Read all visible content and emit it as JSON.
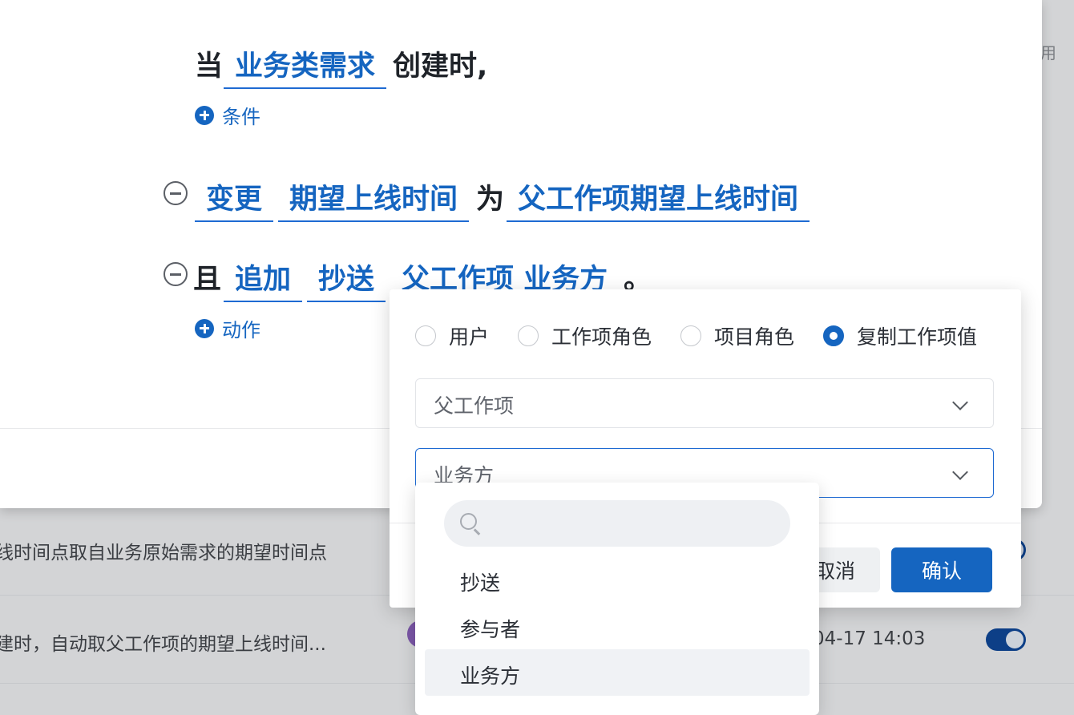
{
  "background": {
    "right_label": "用",
    "rows": [
      {
        "text": "线时间点取自业务原始需求的期望时间点",
        "time": ""
      },
      {
        "text": "建时，自动取父工作项的期望上线时间...",
        "time": "04-17 14:03"
      }
    ]
  },
  "rule": {
    "trigger": {
      "prefix": "当",
      "object": "业务类需求",
      "suffix": "创建时,"
    },
    "add_condition_label": "条件",
    "action1": {
      "verb": "变更",
      "field": "期望上线时间",
      "connector": "为",
      "value": "父工作项期望上线时间"
    },
    "action2": {
      "conjunction": "且",
      "verb": "追加",
      "field": "抄送",
      "value": "父工作项 业务方",
      "end": "。"
    },
    "add_action_label": "动作"
  },
  "popover": {
    "radios": [
      {
        "label": "用户",
        "checked": false
      },
      {
        "label": "工作项角色",
        "checked": false
      },
      {
        "label": "项目角色",
        "checked": false
      },
      {
        "label": "复制工作项值",
        "checked": true
      }
    ],
    "select_source": "父工作项",
    "select_field": "业务方",
    "cancel_label": "取消",
    "confirm_label": "确认"
  },
  "dropdown": {
    "search_placeholder": "",
    "options": [
      "抄送",
      "参与者",
      "业务方"
    ],
    "selected": "业务方"
  },
  "colors": {
    "accent": "#1565c0",
    "toggle_on": "#0d3f87",
    "overlay": "#d3d4d6"
  }
}
